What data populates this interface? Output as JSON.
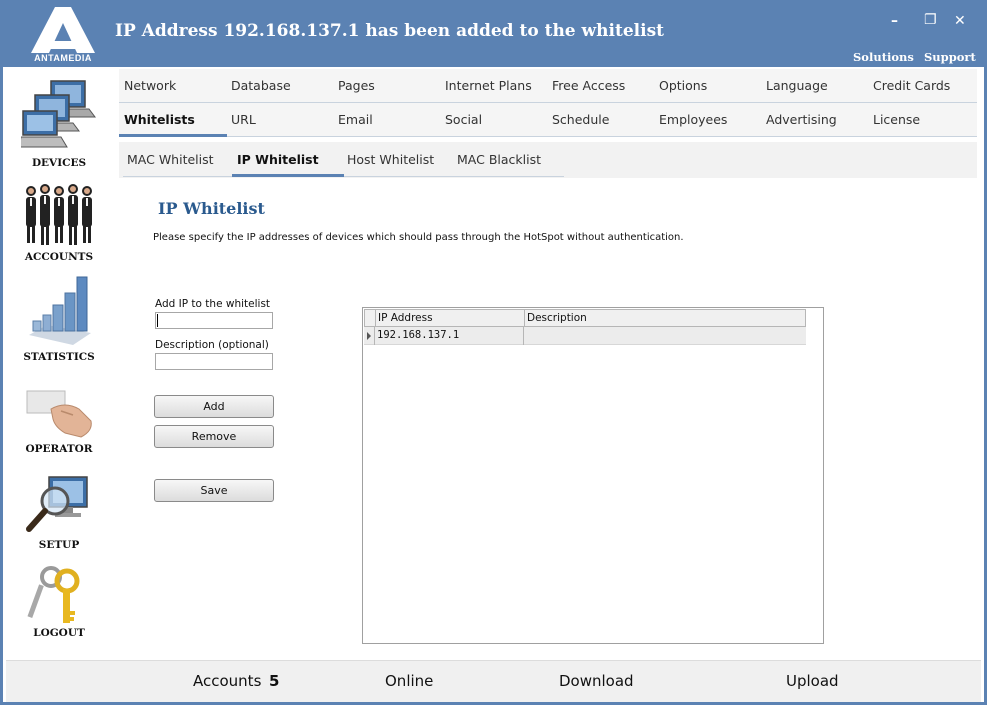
{
  "window": {
    "title": "IP Address 192.168.137.1 has been added to the whitelist",
    "brand": "ANTAMEDIA",
    "controls": {
      "minimize": "–",
      "restore": "❐",
      "close": "✕"
    },
    "links": {
      "solutions": "Solutions",
      "support": "Support"
    }
  },
  "colors": {
    "accent": "#5b82b3",
    "heading": "#2a5a8e",
    "statusbar": "#f0f0f0"
  },
  "sidebar": {
    "items": [
      {
        "label": "DEVICES",
        "icon": "computers-icon"
      },
      {
        "label": "ACCOUNTS",
        "icon": "people-icon"
      },
      {
        "label": "STATISTICS",
        "icon": "bar-chart-icon"
      },
      {
        "label": "OPERATOR",
        "icon": "card-hand-icon"
      },
      {
        "label": "SETUP",
        "icon": "magnifier-monitor-icon"
      },
      {
        "label": "LOGOUT",
        "icon": "keys-icon"
      }
    ]
  },
  "nav": {
    "row1": [
      "Network",
      "Database",
      "Pages",
      "Internet Plans",
      "Free Access",
      "Options",
      "Language",
      "Credit Cards"
    ],
    "row2": [
      "Whitelists",
      "URL",
      "Email",
      "Social",
      "Schedule",
      "Employees",
      "Advertising",
      "License"
    ],
    "active": "Whitelists"
  },
  "subnav": {
    "items": [
      "MAC Whitelist",
      "IP Whitelist",
      "Host Whitelist",
      "MAC Blacklist"
    ],
    "active": "IP Whitelist"
  },
  "content": {
    "heading": "IP Whitelist",
    "description": "Please specify the IP addresses of devices which should pass through the HotSpot without authentication.",
    "ip_label": "Add IP to the whitelist",
    "ip_value": "",
    "desc_label": "Description (optional)",
    "desc_value": "",
    "buttons": {
      "add": "Add",
      "remove": "Remove",
      "save": "Save"
    }
  },
  "grid": {
    "columns": [
      "IP Address",
      "Description"
    ],
    "rows": [
      {
        "ip": "192.168.137.1",
        "description": ""
      }
    ]
  },
  "statusbar": {
    "accounts_label": "Accounts",
    "accounts_count": "5",
    "online": "Online",
    "download": "Download",
    "upload": "Upload"
  }
}
